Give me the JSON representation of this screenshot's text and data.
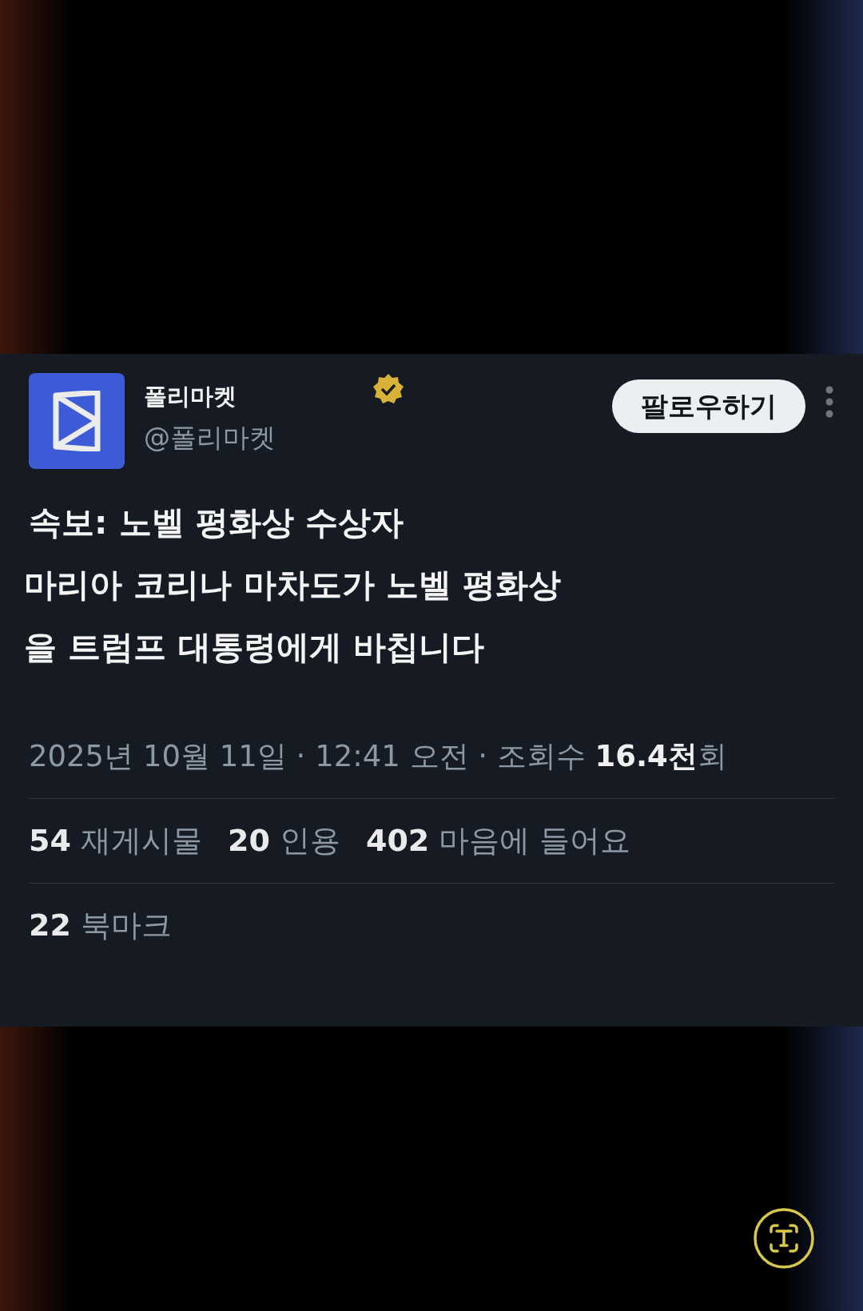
{
  "post": {
    "author_name": "폴리마켓",
    "verified": true,
    "handle": "@폴리마켓",
    "follow_button": "팔로우하기",
    "text_lines": [
      "속보: 노벨 평화상 수상자",
      "마리아 코리나 마차도가 노벨 평화상",
      "을 트럼프 대통령에게 바칩니다"
    ],
    "meta": "2025년 10월 11일 · 12:41 오전 · 조회수 **16.4천**회",
    "stats": [
      {
        "count": "54",
        "label": "재게시물"
      },
      {
        "count": "20",
        "label": "인용"
      },
      {
        "count": "402",
        "label": "마음에 들어요"
      }
    ],
    "bookmarks": {
      "count": "22",
      "label": "북마크"
    }
  }
}
